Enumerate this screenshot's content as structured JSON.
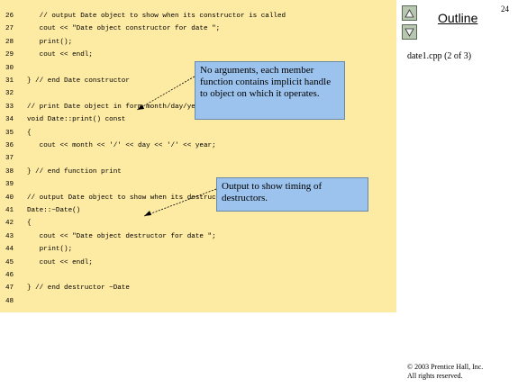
{
  "slide": {
    "number": "24",
    "outline_label": "Outline",
    "file_label": "date1.cpp (2 of 3)",
    "copyright_line1": "© 2003 Prentice Hall, Inc.",
    "copyright_line2": "All rights reserved."
  },
  "nav": {
    "up_icon": "triangle-up",
    "down_icon": "triangle-down",
    "button_color": "#b7c7b0"
  },
  "code": {
    "lines": [
      {
        "num": "26",
        "text": "   // output Date object to show when its constructor is called"
      },
      {
        "num": "27",
        "text": "   cout << \"Date object constructor for date \";"
      },
      {
        "num": "28",
        "text": "   print();"
      },
      {
        "num": "29",
        "text": "   cout << endl;"
      },
      {
        "num": "30",
        "text": ""
      },
      {
        "num": "31",
        "text": "} // end Date constructor"
      },
      {
        "num": "32",
        "text": ""
      },
      {
        "num": "33",
        "text": "// print Date object in form month/day/year"
      },
      {
        "num": "34",
        "text": "void Date::print() const"
      },
      {
        "num": "35",
        "text": "{"
      },
      {
        "num": "36",
        "text": "   cout << month << '/' << day << '/' << year;"
      },
      {
        "num": "37",
        "text": ""
      },
      {
        "num": "38",
        "text": "} // end function print"
      },
      {
        "num": "39",
        "text": ""
      },
      {
        "num": "40",
        "text": "// output Date object to show when its destructor is called"
      },
      {
        "num": "41",
        "text": "Date::~Date()"
      },
      {
        "num": "42",
        "text": "{"
      },
      {
        "num": "43",
        "text": "   cout << \"Date object destructor for date \";"
      },
      {
        "num": "44",
        "text": "   print();"
      },
      {
        "num": "45",
        "text": "   cout << endl;"
      },
      {
        "num": "46",
        "text": ""
      },
      {
        "num": "47",
        "text": "} // end destructor ~Date"
      },
      {
        "num": "48",
        "text": ""
      }
    ],
    "background": "#fdeaa3"
  },
  "callouts": {
    "member_function": "No arguments, each member function contains implicit handle to object on which it operates.",
    "destructor_output": "Output to show timing of destructors.",
    "color": "#9cc3ee"
  }
}
